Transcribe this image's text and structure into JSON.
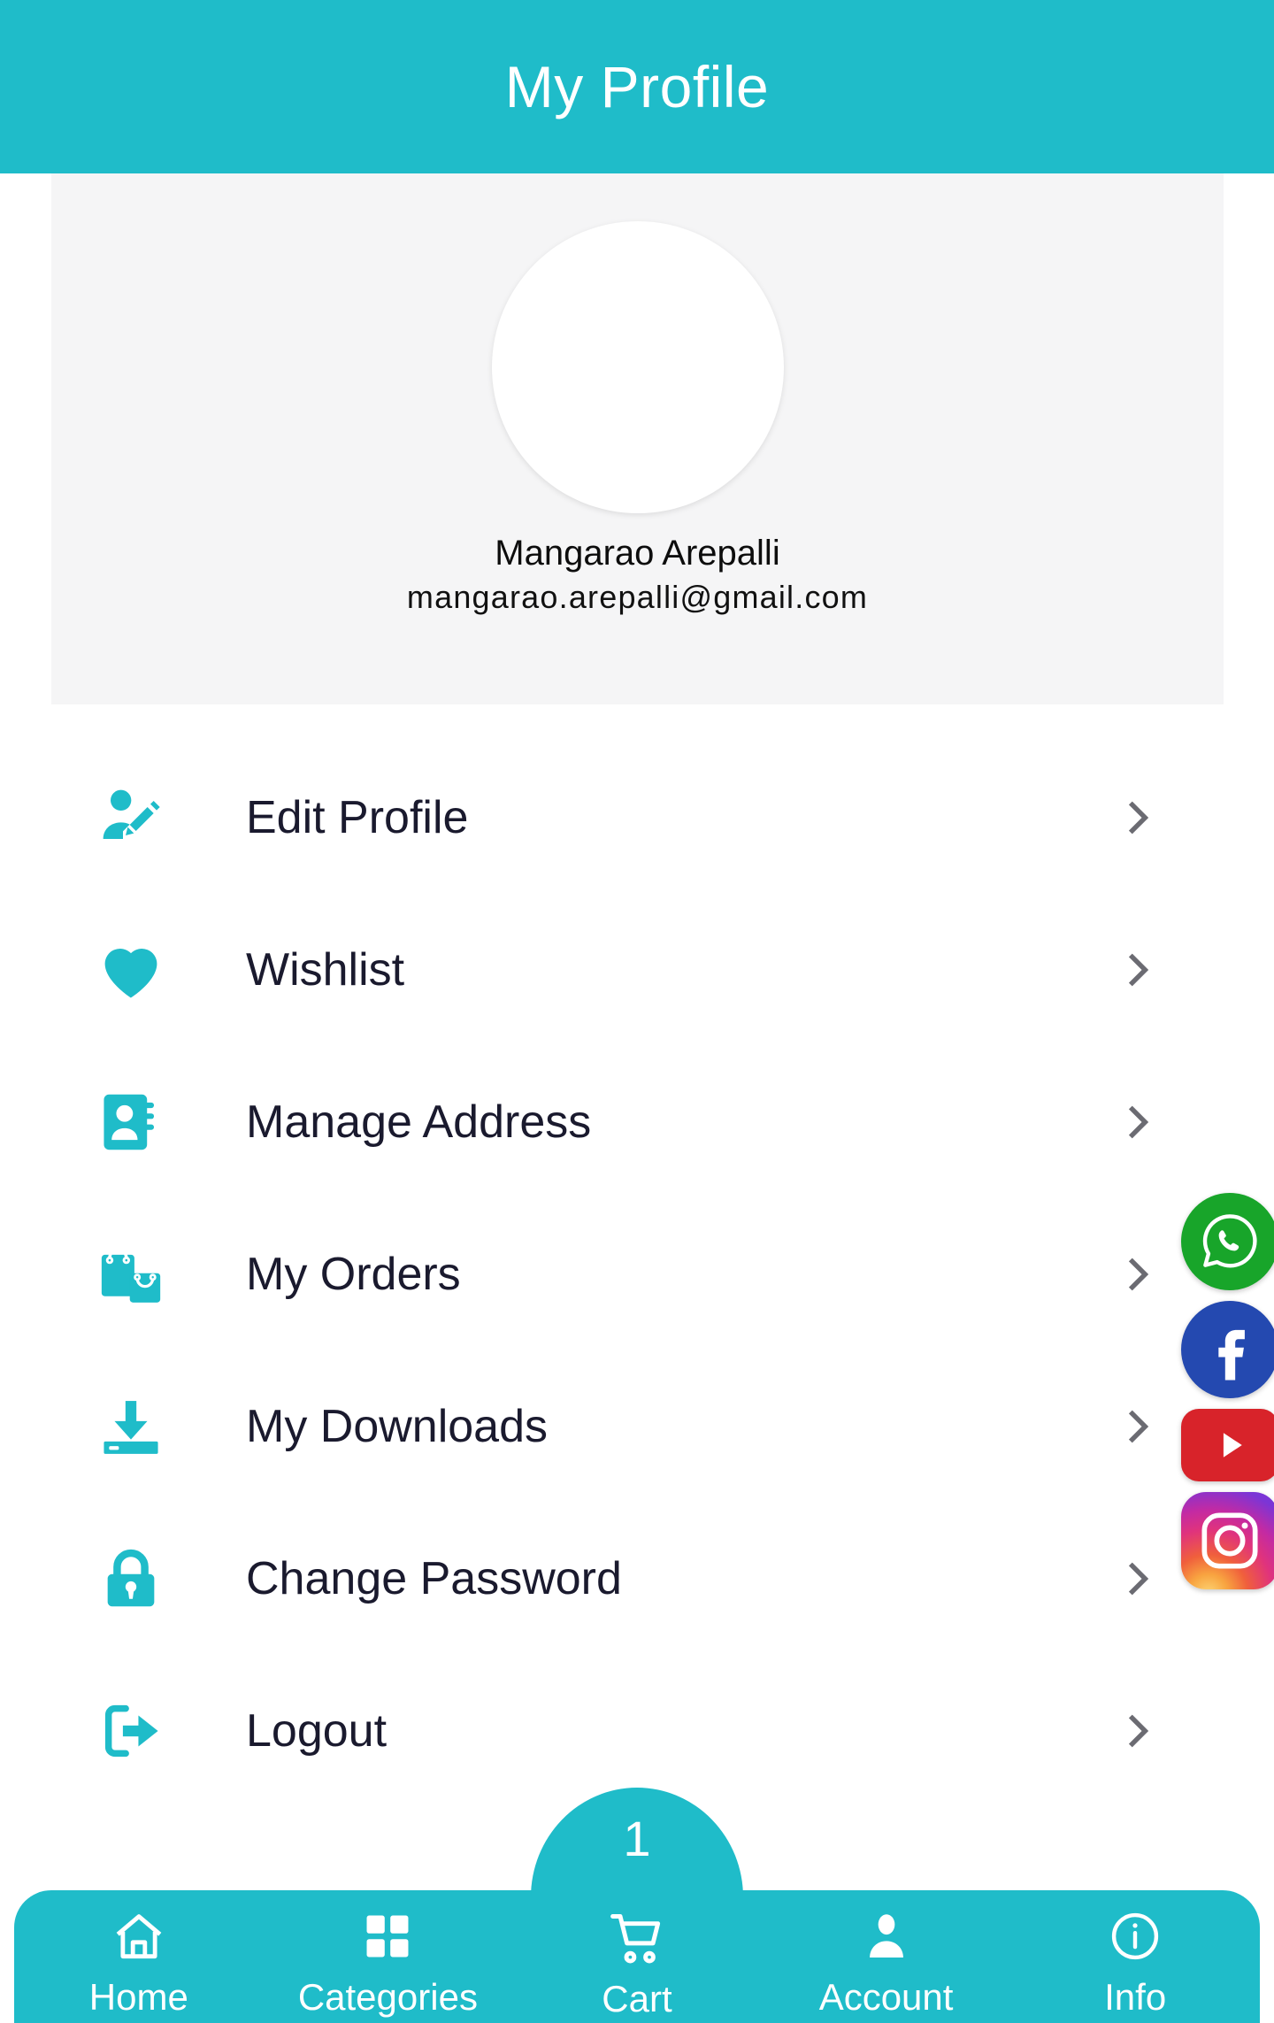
{
  "theme": {
    "primary": "#1fbcc9",
    "card_bg": "#f5f5f6",
    "menu_text": "#1a1a2e",
    "chevron": "#6b6b72"
  },
  "header": {
    "title": "My Profile"
  },
  "profile": {
    "avatar_icon": "avatar-placeholder",
    "name": "Mangarao Arepalli",
    "email": "mangarao.arepalli@gmail.com"
  },
  "menu": {
    "items": [
      {
        "label": "Edit Profile",
        "icon": "edit-profile-icon",
        "chevron": "chevron-right-icon"
      },
      {
        "label": "Wishlist",
        "icon": "heart-icon",
        "chevron": "chevron-right-icon"
      },
      {
        "label": "Manage Address",
        "icon": "address-book-icon",
        "chevron": "chevron-right-icon"
      },
      {
        "label": "My Orders",
        "icon": "shopping-bags-icon",
        "chevron": "chevron-right-icon"
      },
      {
        "label": "My Downloads",
        "icon": "download-icon",
        "chevron": "chevron-right-icon"
      },
      {
        "label": "Change Password",
        "icon": "lock-icon",
        "chevron": "chevron-right-icon"
      },
      {
        "label": "Logout",
        "icon": "logout-icon",
        "chevron": "chevron-right-icon"
      }
    ]
  },
  "social": {
    "items": [
      {
        "name": "whatsapp-icon",
        "color": "#18a52a"
      },
      {
        "name": "facebook-icon",
        "color": "#2449b0"
      },
      {
        "name": "youtube-icon",
        "color": "#d8232a"
      },
      {
        "name": "instagram-icon",
        "color": "#e0337c"
      }
    ]
  },
  "bottom_nav": {
    "cart_badge": "1",
    "items": [
      {
        "label": "Home",
        "icon": "home-icon"
      },
      {
        "label": "Categories",
        "icon": "grid-icon"
      },
      {
        "label": "Cart",
        "icon": "cart-icon"
      },
      {
        "label": "Account",
        "icon": "person-icon"
      },
      {
        "label": "Info",
        "icon": "info-icon"
      }
    ]
  }
}
